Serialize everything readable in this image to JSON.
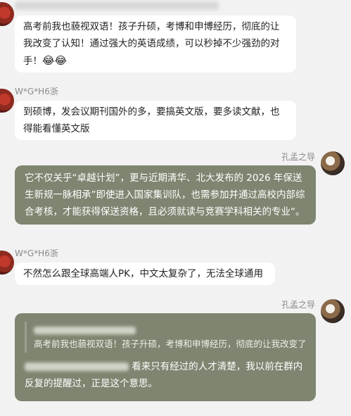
{
  "messages": {
    "m1": {
      "text": "高考前我也藐视双语！孩子升硕，考博和申博经历，彻底的让我改变了认知！通过强大的英语成绩，可以秒掉不少强劲的对手！",
      "emoji": "😂😂"
    },
    "m2": {
      "sender": "W*G*H6浙",
      "text": "到硕博，发会议期刊国外的多，要搞英文版，要多读文献，也得能看懂英文版"
    },
    "m3": {
      "sender": "孔孟之导",
      "text": "它不仅关乎“卓越计划”，更与近期清华、北大发布的 2026 年保送生新规一脉相承”即使进入国家集训队，也需参加并通过高校内部综合考核，才能获得保送资格，且必须就读与竞赛学科相关的专业“。"
    },
    "m4": {
      "sender": "W*G*H6浙",
      "text": "不然怎么跟全球高端人PK，中文太复杂了，无法全球通用"
    },
    "m5": {
      "sender": "孔孟之导",
      "quote": "高考前我也藐视双语！孩子升硕，考博和申博经历，彻底的让我改变了...",
      "text": "看来只有经过的人才清楚，我以前在群内反复的提醒过，正是这个意思。"
    }
  }
}
